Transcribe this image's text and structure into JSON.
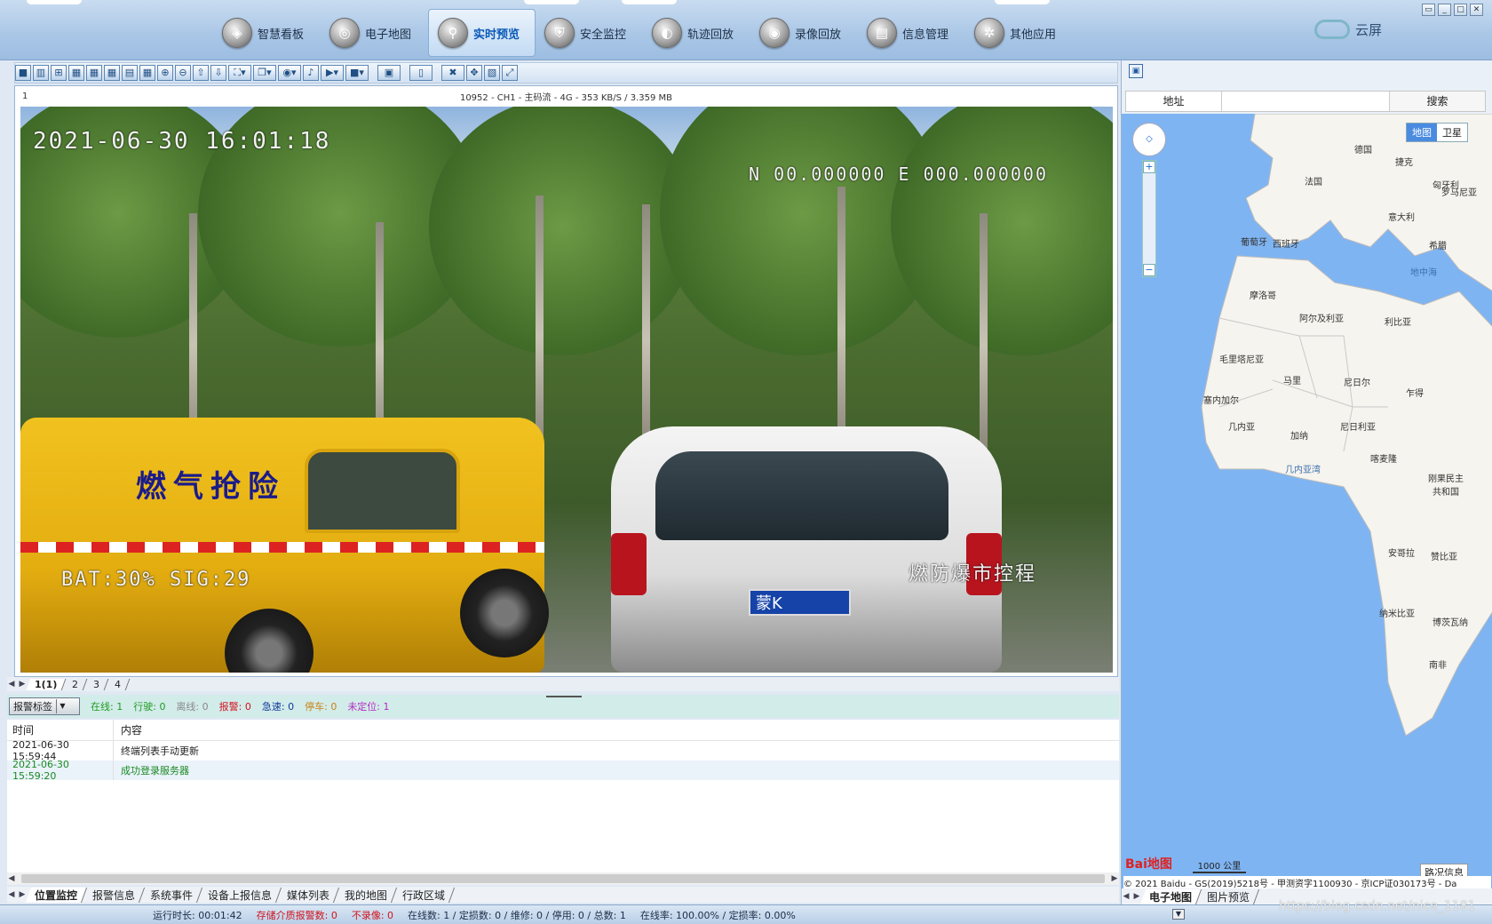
{
  "nav": {
    "items": [
      {
        "label": "智慧看板",
        "icon": "dashboard-icon"
      },
      {
        "label": "电子地图",
        "icon": "globe-icon"
      },
      {
        "label": "实时预览",
        "icon": "magnifier-icon",
        "active": true
      },
      {
        "label": "安全监控",
        "icon": "shield-icon"
      },
      {
        "label": "轨迹回放",
        "icon": "track-icon"
      },
      {
        "label": "录像回放",
        "icon": "record-icon"
      },
      {
        "label": "信息管理",
        "icon": "info-icon"
      },
      {
        "label": "其他应用",
        "icon": "apps-icon"
      }
    ],
    "brand": "云屏"
  },
  "video": {
    "index": "1",
    "caption": "10952 - CH1 - 主码流 - 4G - 353 KB/S / 3.359 MB",
    "osd_time": "2021-06-30 16:01:18",
    "osd_coords": "N 00.000000 E 000.000000",
    "osd_bat": "BAT:30% SIG:29",
    "osd_right": "燃防爆市控程",
    "truck_text": "燃气抢险",
    "plate": "蒙K"
  },
  "video_tabs": [
    "1(1)",
    "2",
    "3",
    "4"
  ],
  "status": {
    "select": "报警标签",
    "online_label": "在线:",
    "online": "1",
    "moving_label": "行驶:",
    "moving": "0",
    "offline_label": "离线:",
    "offline": "0",
    "alarm_label": "报警:",
    "alarm": "0",
    "speeding_label": "急速:",
    "speeding": "0",
    "parked_label": "停车:",
    "parked": "0",
    "unlocated_label": "未定位:",
    "unlocated": "1"
  },
  "log": {
    "col_time": "时间",
    "col_content": "内容",
    "rows": [
      {
        "time": "2021-06-30 15:59:44",
        "content": "终端列表手动更新"
      },
      {
        "time": "2021-06-30 15:59:20",
        "content": "成功登录服务器"
      }
    ]
  },
  "bottom_tabs": [
    "位置监控",
    "报警信息",
    "系统事件",
    "设备上报信息",
    "媒体列表",
    "我的地图",
    "行政区域"
  ],
  "map": {
    "search_label": "地址",
    "search_placeholder": "",
    "search_button": "搜索",
    "type_map": "地图",
    "type_sat": "卫星",
    "scale": "1000 公里",
    "baidu": "Bai地图",
    "traffic": "路况信息",
    "copyright": "© 2021 Baidu - GS(2019)5218号 - 甲测资字1100930 - 京ICP证030173号 - Da",
    "labels": [
      {
        "t": "德国"
      },
      {
        "t": "捷克"
      },
      {
        "t": "法国"
      },
      {
        "t": "匈牙利"
      },
      {
        "t": "罗马尼亚"
      },
      {
        "t": "意大利"
      },
      {
        "t": "葡萄牙"
      },
      {
        "t": "西班牙"
      },
      {
        "t": "希腊"
      },
      {
        "t": "地中海"
      },
      {
        "t": "摩洛哥"
      },
      {
        "t": "阿尔及利亚"
      },
      {
        "t": "利比亚"
      },
      {
        "t": "毛里塔尼亚"
      },
      {
        "t": "马里"
      },
      {
        "t": "尼日尔"
      },
      {
        "t": "乍得"
      },
      {
        "t": "塞内加尔"
      },
      {
        "t": "几内亚"
      },
      {
        "t": "尼日利亚"
      },
      {
        "t": "加纳"
      },
      {
        "t": "喀麦隆"
      },
      {
        "t": "几内亚湾"
      },
      {
        "t": "刚果民主共和国"
      },
      {
        "t": "安哥拉"
      },
      {
        "t": "赞比亚"
      },
      {
        "t": "纳米比亚"
      },
      {
        "t": "博茨瓦纳"
      },
      {
        "t": "南非"
      }
    ],
    "tabs": [
      "电子地图",
      "图片预览"
    ]
  },
  "footer": {
    "runtime_label": "运行时长:",
    "runtime": "00:01:42",
    "storage_alarm": "存储介质报警数: 0",
    "no_record": "不录像: 0",
    "online": "在线数: 1 / 定损数: 0 / 维修: 0 / 停用: 0 / 总数: 1",
    "rates": "在线率: 100.00% / 定损率: 0.00%"
  },
  "watermark": "https://blog.csdn.net/nice_1181"
}
